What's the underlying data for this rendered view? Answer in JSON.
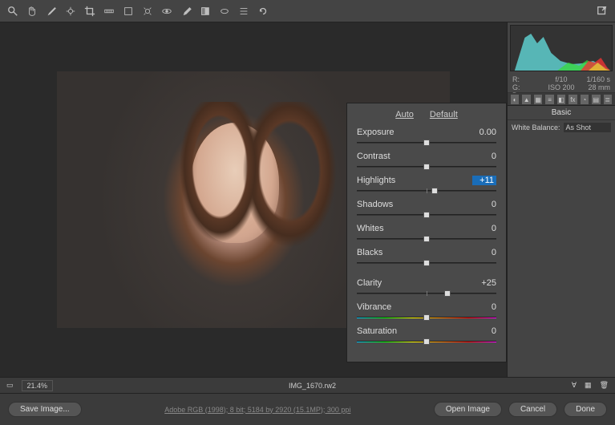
{
  "toolbar": {
    "tools": [
      "zoom",
      "hand",
      "wb-picker",
      "color-sampler",
      "target",
      "crop",
      "straighten",
      "spot",
      "redeye",
      "brush",
      "gradient",
      "radial",
      "rotate-ccw",
      "rotate-cw"
    ]
  },
  "histogram": {
    "rgb": {
      "R": "",
      "G": "",
      "B": ""
    },
    "aperture": "f/10",
    "shutter": "1/160 s",
    "iso": "ISO 200",
    "focal": "28 mm"
  },
  "panel": {
    "title": "Basic",
    "wb_label": "White Balance:",
    "wb_value": "As Shot",
    "auto": "Auto",
    "default": "Default",
    "sliders": [
      {
        "label": "Exposure",
        "value": "0.00",
        "pos": 50
      },
      {
        "label": "Contrast",
        "value": "0",
        "pos": 50
      },
      {
        "label": "Highlights",
        "value": "+11",
        "pos": 56,
        "highlight": true
      },
      {
        "label": "Shadows",
        "value": "0",
        "pos": 50
      },
      {
        "label": "Whites",
        "value": "0",
        "pos": 50
      },
      {
        "label": "Blacks",
        "value": "0",
        "pos": 50
      }
    ],
    "sliders2": [
      {
        "label": "Clarity",
        "value": "+25",
        "pos": 65
      },
      {
        "label": "Vibrance",
        "value": "0",
        "pos": 50,
        "color": true
      },
      {
        "label": "Saturation",
        "value": "0",
        "pos": 50,
        "color": true
      }
    ]
  },
  "status": {
    "zoom": "21.4%",
    "filename": "IMG_1670.rw2"
  },
  "bottom": {
    "save": "Save Image...",
    "info": "Adobe RGB (1998); 8 bit; 5184 by 2920 (15.1MP); 300 ppi",
    "open": "Open Image",
    "cancel": "Cancel",
    "done": "Done"
  }
}
